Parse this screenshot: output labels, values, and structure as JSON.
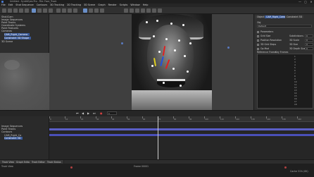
{
  "window": {
    "title": "Untitled - SynthEyes Pro - File: Face_Track",
    "controls": [
      "—",
      "▢",
      "✕"
    ]
  },
  "menu": [
    "File",
    "Edit",
    "Shot Sequence",
    "Contours",
    "3D Tracking",
    "2D Tracking",
    "3D Scene",
    "Graph",
    "Render",
    "Scripts",
    "Window",
    "Help"
  ],
  "scene_tree": {
    "items": [
      {
        "label": "Shot/Cam",
        "selected": false
      },
      {
        "label": "Image Sequences",
        "selected": false
      },
      {
        "label": "Point Tracks",
        "selected": false
      },
      {
        "label": "Coordinate Systems",
        "selected": false
      },
      {
        "label": "Point Features",
        "selected": false
      },
      {
        "label": "Cameras",
        "selected": false
      },
      {
        "label": "CAM_Right_Camera",
        "selected": true
      },
      {
        "label": "Constraint 3D Shape",
        "selected": true
      },
      {
        "label": "3D Scene",
        "selected": false
      }
    ]
  },
  "right_panel": {
    "tabs": [
      "Object",
      "CAM_Right_Camera",
      "Constraint 3D"
    ],
    "name_label": "Obj",
    "name_value": "Default",
    "checkboxes": [
      {
        "label": "Parameters"
      },
      {
        "label": "Grid Size"
      },
      {
        "label": "Position Resolution"
      },
      {
        "label": "3D Grid Steps"
      },
      {
        "label": "Op Mod"
      }
    ],
    "right_fields": [
      {
        "label": "Subdivisions",
        "value": "0"
      },
      {
        "label": "3D Scale",
        "value": "0"
      },
      {
        "label": "3D Size",
        "value": "0"
      },
      {
        "label": "3D Depth Size",
        "value": "0"
      }
    ],
    "table_headers": [
      "Reference Frame",
      "Key Frames"
    ],
    "row_numbers": [
      "1",
      "2",
      "3",
      "4",
      "5",
      "6",
      "7",
      "8",
      "9",
      "10",
      "11",
      "12",
      "13",
      "14",
      "15",
      "16",
      "17",
      "18",
      "19",
      "20"
    ]
  },
  "timeline": {
    "controls": [
      "⏮",
      "◀",
      "▶",
      "⏭",
      "●"
    ],
    "frame_label": "1",
    "ticks": [
      "0",
      "10",
      "20",
      "30",
      "40",
      "50",
      "60",
      "70",
      "80",
      "90",
      "100",
      "110",
      "120",
      "130",
      "140",
      "150",
      "160"
    ],
    "tracks": [
      {
        "label": "Image Sequences"
      },
      {
        "label": "Point Tracks"
      },
      {
        "label": "Contours"
      },
      {
        "label": "CAM_Right_Ca"
      },
      {
        "label": "Constraint 3D"
      }
    ]
  },
  "bottom_tabs": [
    "Track View",
    "Graph Editor",
    "Track Editor",
    "Track Status"
  ],
  "status": {
    "left": "Track View",
    "center": "Frame 00001",
    "right": "Cache 31% (0K)"
  },
  "colors": {
    "selection": "#3a5a9a",
    "track_bar": "#5b5fc7",
    "marker_red": "#e02020",
    "marker_blue": "#2050e0",
    "marker_yellow": "#e0d020"
  }
}
